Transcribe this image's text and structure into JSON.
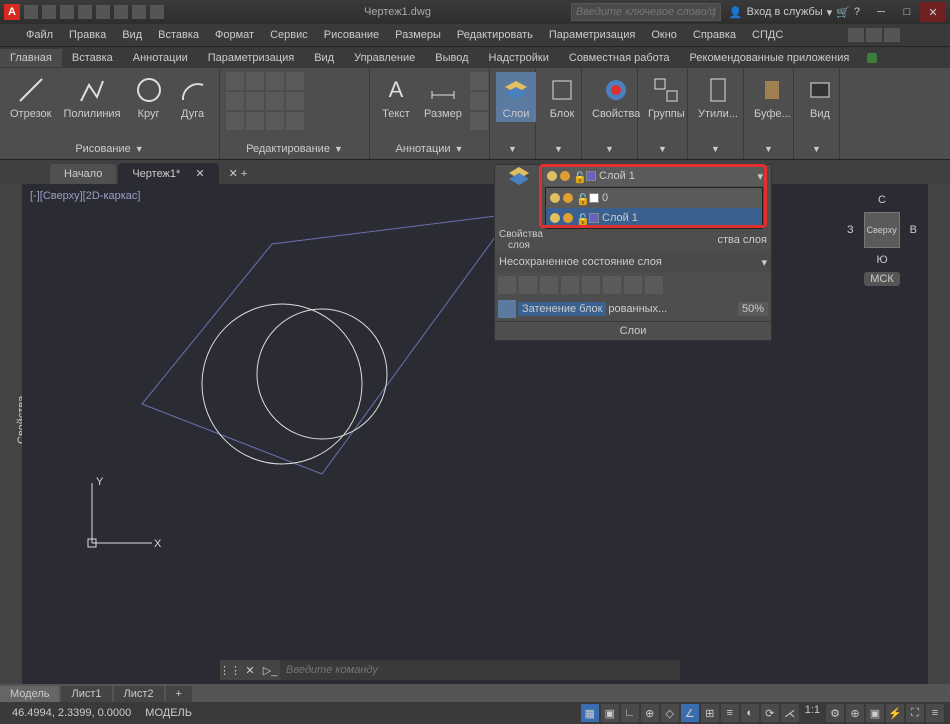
{
  "window": {
    "title": "Чертеж1.dwg",
    "search_placeholder": "Введите ключевое слово/фразу",
    "login": "Вход в службы"
  },
  "menus": [
    "Файл",
    "Правка",
    "Вид",
    "Вставка",
    "Формат",
    "Сервис",
    "Рисование",
    "Размеры",
    "Редактировать",
    "Параметризация",
    "Окно",
    "Справка",
    "СПДС"
  ],
  "ribbon_tabs": [
    "Главная",
    "Вставка",
    "Аннотации",
    "Параметризация",
    "Вид",
    "Управление",
    "Вывод",
    "Надстройки",
    "Совместная работа",
    "Рекомендованные приложения"
  ],
  "ribbon": {
    "draw": {
      "title": "Рисование",
      "buttons": [
        "Отрезок",
        "Полилиния",
        "Круг",
        "Дуга"
      ]
    },
    "edit": {
      "title": "Редактирование"
    },
    "anno": {
      "title": "Аннотации",
      "buttons": [
        "Текст",
        "Размер"
      ]
    },
    "layers": {
      "title": "Слои",
      "btn": "Слои",
      "props": "Свойства\nслоя",
      "state_label": "ства слоя"
    },
    "block": {
      "title": "Блок"
    },
    "props": {
      "title": "Свойства"
    },
    "groups": {
      "title": "Группы"
    },
    "utils": {
      "title": "Утилиты",
      "btn": "Утили..."
    },
    "clip": {
      "title": "Буфе..."
    },
    "view": {
      "title": "Вид"
    }
  },
  "doc_tabs": {
    "start": "Начало",
    "active": "Чертеж1*"
  },
  "viewport": {
    "label": "[-][Сверху][2D-каркас]",
    "sidebar_label": "Свойства"
  },
  "navcube": {
    "n": "С",
    "s": "Ю",
    "e": "В",
    "w": "З",
    "face": "Сверху",
    "wcs": "МСК"
  },
  "layers_panel": {
    "current": "Слой 1",
    "items": [
      {
        "name": "0",
        "color": "#ffffff",
        "selected": false
      },
      {
        "name": "Слой 1",
        "color": "#6a60c0",
        "selected": true
      }
    ],
    "unsaved": "Несохраненное состояние слоя",
    "block_shade": "Затенение блок",
    "block_suffix": "рованных...",
    "opacity": "50%",
    "footer": "Слои"
  },
  "cmdline": {
    "placeholder": "Введите команду"
  },
  "model_tabs": [
    "Модель",
    "Лист1",
    "Лист2"
  ],
  "status": {
    "coords": "46.4994, 2.3399, 0.0000",
    "mode": "МОДЕЛЬ",
    "scale": "1:1"
  },
  "ucs": {
    "x": "X",
    "y": "Y"
  }
}
